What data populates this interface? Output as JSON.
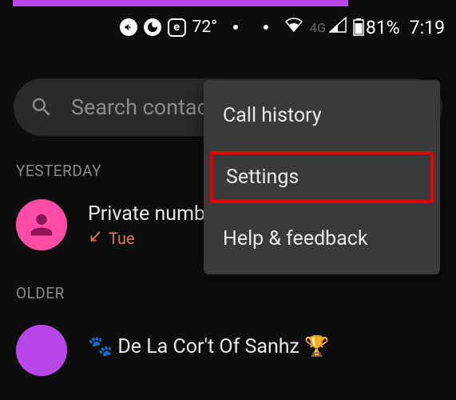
{
  "status": {
    "temperature": "72°",
    "network_type": "4G",
    "battery": "81%",
    "time": "7:19"
  },
  "search": {
    "placeholder": "Search contacts"
  },
  "sections": {
    "yesterday": "YESTERDAY",
    "older": "OLDER"
  },
  "calls": {
    "yesterday": {
      "name": "Private number",
      "day": "Tue"
    },
    "older": {
      "name": "🐾 De La Cor't Of Sanhz 🏆"
    }
  },
  "menu": {
    "call_history": "Call history",
    "settings": "Settings",
    "help": "Help & feedback"
  }
}
